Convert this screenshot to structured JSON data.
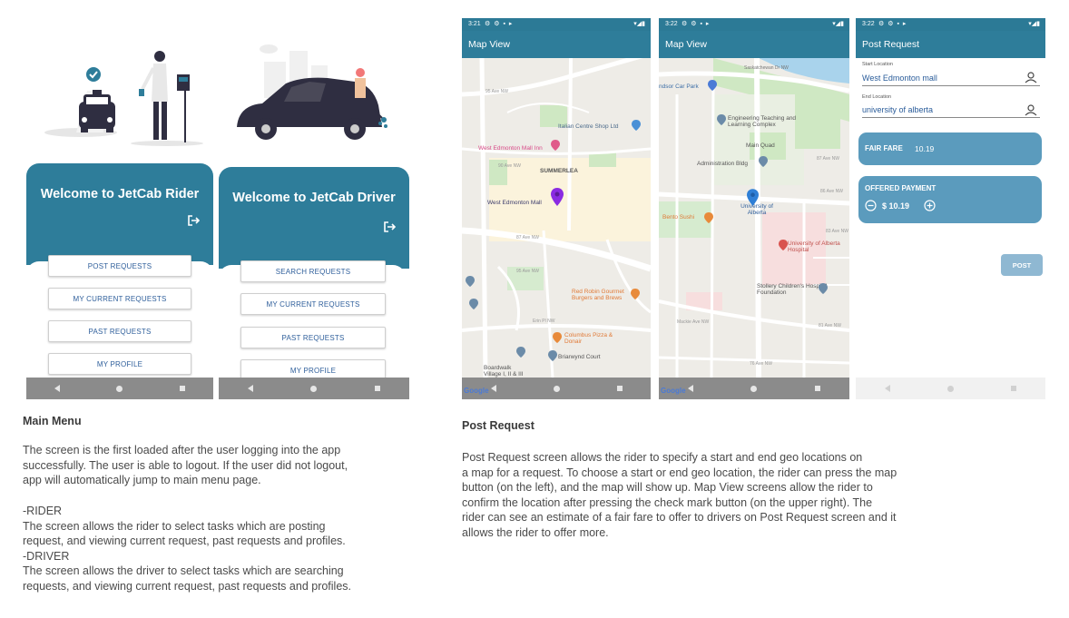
{
  "rider_screen": {
    "title": "Welcome to JetCab Rider",
    "buttons": [
      "POST REQUESTS",
      "MY CURRENT REQUESTS",
      "PAST REQUESTS",
      "MY PROFILE"
    ]
  },
  "driver_screen": {
    "title": "Welcome to JetCab Driver",
    "buttons": [
      "SEARCH REQUESTS",
      "MY CURRENT REQUESTS",
      "PAST REQUESTS",
      "MY PROFILE"
    ]
  },
  "map_view_1": {
    "time": "3:21",
    "title": "Map View",
    "labels": [
      "Italian Centre Shop Ltd",
      "West Edmonton Mall Inn",
      "SUMMERLEA",
      "West Edmonton Mall",
      "Red Robin Gourmet Burgers and Brews",
      "Columbus Pizza & Donair",
      "Briarwynd Court",
      "Boardwalk Village I, II & III",
      "95 Ave NW",
      "87 Ave NW",
      "90 Ave NW",
      "Erin Pl NW",
      "95 Ave NW"
    ],
    "attribution": "Google"
  },
  "map_view_2": {
    "time": "3:22",
    "title": "Map View",
    "labels": [
      "Saskatchewan Dr NW",
      "ndsor Car Park",
      "Engineering Teaching and Learning Complex",
      "Main Quad",
      "Administration Bldg",
      "University of Alberta",
      "Bento Sushi",
      "University of Alberta Hospital",
      "Stollery Children's Hospital Foundation",
      "87 Ave NW",
      "83 Ave NW",
      "86 Ave NW",
      "81 Ave NW",
      "Mackie Ave NW",
      "76 Ave NW"
    ],
    "attribution": "Google"
  },
  "post_request": {
    "time": "3:22",
    "title": "Post Request",
    "start_label": "Start Location",
    "start_value": "West Edmonton mall",
    "end_label": "End Location",
    "end_value": "university of alberta",
    "fair_fare_label": "FAIR FARE",
    "fair_fare_value": "10.19",
    "offered_label": "OFFERED PAYMENT",
    "offered_value": "$ 10.19",
    "post_button": "POST"
  },
  "main_menu_section": {
    "heading": "Main Menu",
    "paragraph1": "The screen is the first loaded after the user logging into the app\nsuccessfully. The user is able to logout. If the user did not logout,\napp will automatically jump to main menu page.",
    "paragraph2": "-RIDER\nThe screen allows the rider to select tasks which are posting\nrequest, and viewing current request, past requests and profiles.\n-DRIVER\nThe screen allows the driver to select tasks which are searching\nrequests, and viewing current request, past requests and profiles."
  },
  "post_request_section": {
    "heading": "Post Request",
    "paragraph": "Post Request screen allows the rider to specify a start and end geo locations on\na map for a request. To choose a start or end geo location, the rider can press the map\nbutton (on the left), and the map will show up. Map View screens allow the rider to\nconfirm the location after pressing the check mark button (on the upper right). The\nrider can see an estimate of a fair fare to offer to drivers on Post Request screen and it\nallows the rider to offer more."
  },
  "colors": {
    "teal": "#2e7d9a",
    "card": "#5b9bbd",
    "button_text": "#2f5f9b",
    "pin_purple": "#8a2be2",
    "pin_blue": "#2f7fd6"
  }
}
